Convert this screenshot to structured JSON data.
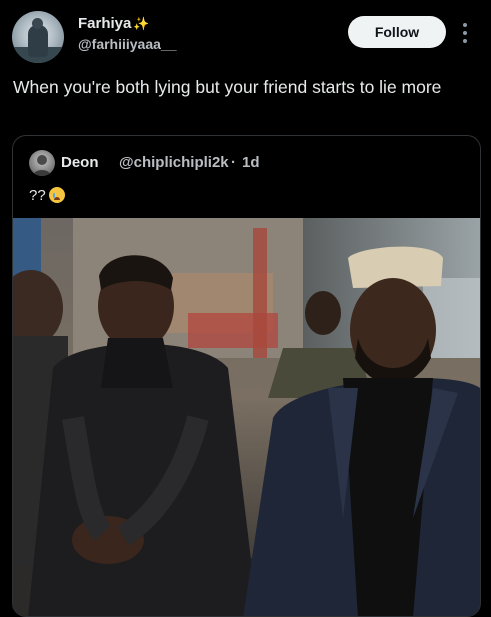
{
  "author": {
    "display_name": "Farhiya",
    "sparkle": "✨",
    "handle": "@farhiiiyaaa__"
  },
  "follow_label": "Follow",
  "tweet_text": "When you're both lying but your friend starts to lie more",
  "quoted": {
    "display_name": "Deon",
    "handle": "@chiplichipli2k",
    "separator": "·",
    "time": "1d",
    "text": "??"
  },
  "icons": {
    "more": "more-vertical-icon",
    "emoji": "crying-face-icon",
    "sparkle": "sparkles-icon"
  },
  "colors": {
    "background": "#000000",
    "text": "#e7e9ea",
    "secondary_text": "#b9bec3",
    "follow_bg": "#eff3f4",
    "border": "#2f3336"
  }
}
